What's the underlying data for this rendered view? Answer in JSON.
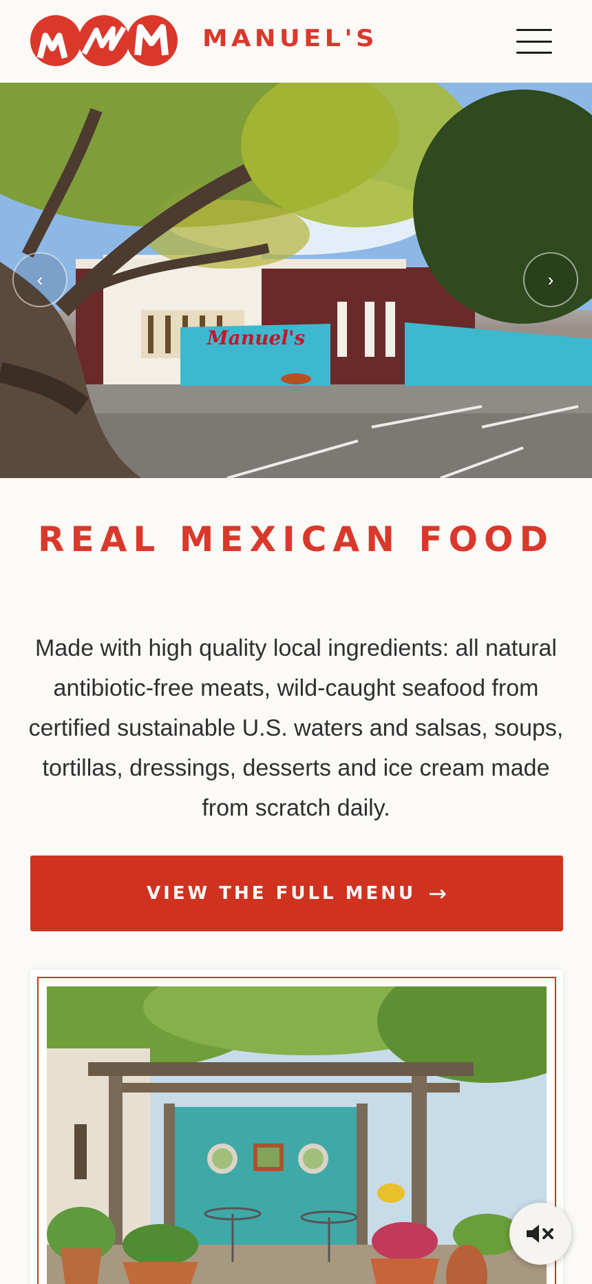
{
  "brand": {
    "name": "MANUEL'S",
    "logo_letters": [
      "M",
      "M",
      "M"
    ],
    "color": "#d9382b"
  },
  "header": {
    "menu_icon": "hamburger-menu-icon"
  },
  "hero": {
    "prev_symbol": "‹",
    "next_symbol": "›",
    "sign_text": "Manuel's"
  },
  "intro": {
    "headline": "REAL MEXICAN FOOD",
    "description": "Made with high quality local ingredients: all natural antibiotic-free meats, wild-caught seafood from certified sustainable U.S. waters and salsas, soups, tortillas, dressings, desserts and ice cream made from scratch daily."
  },
  "cta": {
    "label": "VIEW THE FULL MENU",
    "arrow": "→",
    "color": "#cf3320"
  },
  "audio": {
    "icon": "speaker-muted-icon",
    "symbol": "🔇"
  }
}
